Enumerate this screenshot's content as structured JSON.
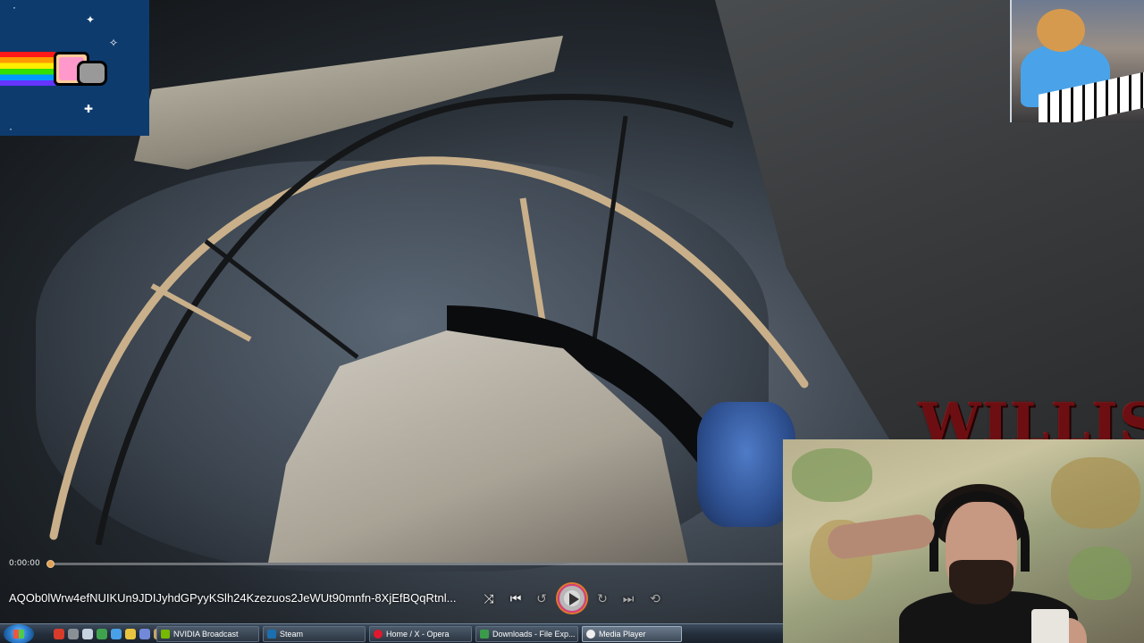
{
  "player": {
    "elapsed": "0:00:00",
    "progress": 0.005,
    "title": "AQOb0lWrw4efNUIKUn9JDIJyhdGPyyKSlh24Kzezuos2JeWUt90mnfn-8XjEfBQqRtnl...",
    "controls": {
      "shuffle": "⤨",
      "previous": "⏮",
      "rewind": "↺",
      "forward": "↻",
      "next": "⏭",
      "repeat": "⟲"
    },
    "accent_color": "#e07a2f"
  },
  "overlay": {
    "streamer_name": "WILLIS"
  },
  "taskbar": {
    "buttons": [
      {
        "label": "NVIDIA Broadcast",
        "icon": "nvidia-icon",
        "color": "#76b900"
      },
      {
        "label": "Steam",
        "icon": "steam-icon",
        "color": "#1b6fb0"
      },
      {
        "label": "Home / X - Opera",
        "icon": "opera-icon",
        "color": "#e0182d"
      },
      {
        "label": "Downloads - File Exp...",
        "icon": "folder-icon",
        "color": "#3a9c4a"
      },
      {
        "label": "Media Player",
        "icon": "media-player-icon",
        "color": "#f0f0f0"
      }
    ],
    "quick_launch": [
      {
        "icon": "red-app-icon",
        "color": "#d93b2a"
      },
      {
        "icon": "gray-app-icon",
        "color": "#8a8f96"
      },
      {
        "icon": "window-icon",
        "color": "#c7d3e0"
      },
      {
        "icon": "green-app-icon",
        "color": "#3fa34d"
      },
      {
        "icon": "browser-icon",
        "color": "#4aa0e6"
      },
      {
        "icon": "chrome-icon",
        "color": "#e8c440"
      },
      {
        "icon": "discord-icon",
        "color": "#7289da"
      },
      {
        "icon": "settings-icon",
        "color": "#c9a46a"
      }
    ]
  }
}
